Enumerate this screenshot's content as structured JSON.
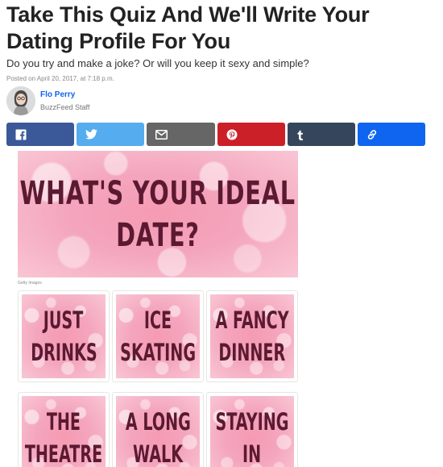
{
  "article": {
    "title": "Take This Quiz And We'll Write Your Dating Profile For You",
    "description": "Do you try and make a joke? Or will you keep it sexy and simple?",
    "posted": "Posted on April 20, 2017, at 7:18 p.m."
  },
  "author": {
    "name": "Flo Perry",
    "role": "BuzzFeed Staff"
  },
  "share": [
    {
      "network": "facebook",
      "icon": "facebook-icon",
      "color": "#3b5998"
    },
    {
      "network": "twitter",
      "icon": "twitter-icon",
      "color": "#55acee"
    },
    {
      "network": "email",
      "icon": "email-icon",
      "color": "#666666"
    },
    {
      "network": "pinterest",
      "icon": "pinterest-icon",
      "color": "#cb2027"
    },
    {
      "network": "tumblr",
      "icon": "tumblr-icon",
      "color": "#35465c"
    },
    {
      "network": "link",
      "icon": "link-icon",
      "color": "#0f65ef"
    }
  ],
  "quiz": {
    "question_lines": [
      "WHAT'S YOUR IDEAL",
      "DATE?"
    ],
    "image_credit": "Getty Images",
    "answers": [
      {
        "lines": [
          "JUST",
          "DRINKS"
        ]
      },
      {
        "lines": [
          "ICE",
          "SKATING"
        ]
      },
      {
        "lines": [
          "A FANCY",
          "DINNER"
        ]
      },
      {
        "lines": [
          "THE",
          "THEATRE"
        ]
      },
      {
        "lines": [
          "A LONG",
          "WALK"
        ]
      },
      {
        "lines": [
          "STAYING",
          "IN"
        ]
      }
    ]
  },
  "colors": {
    "headline": "#222222",
    "author_link": "#0f65ef",
    "quiz_text": "#5b1a32",
    "quiz_pink": "#f4a5bd"
  }
}
